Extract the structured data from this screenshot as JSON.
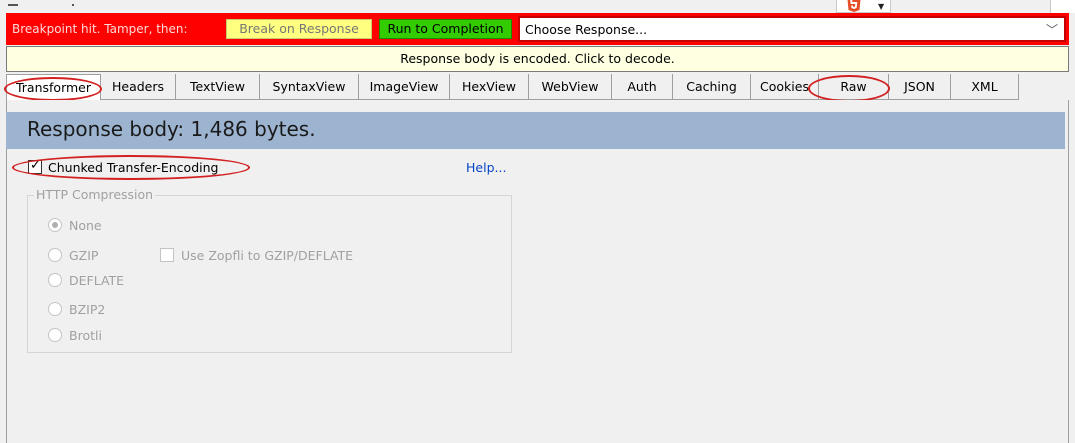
{
  "breakpoint": {
    "label": "Breakpoint hit. Tamper, then:",
    "break_on_response": "Break on Response",
    "run_to_completion": "Run to Completion",
    "choose_response": "Choose Response..."
  },
  "notice": "Response body is encoded. Click to decode.",
  "tabs": [
    "Transformer",
    "Headers",
    "TextView",
    "SyntaxView",
    "ImageView",
    "HexView",
    "WebView",
    "Auth",
    "Caching",
    "Cookies",
    "Raw",
    "JSON",
    "XML"
  ],
  "active_tab": "Transformer",
  "response_body": "Response body: 1,486 bytes.",
  "chunked": {
    "label": "Chunked Transfer-Encoding",
    "checked": true
  },
  "help": "Help...",
  "compression": {
    "title": "HTTP Compression",
    "options": [
      "None",
      "GZIP",
      "DEFLATE",
      "BZIP2",
      "Brotli"
    ],
    "selected": "None",
    "zopfli_label": "Use Zopfli to GZIP/DEFLATE",
    "zopfli_checked": false
  },
  "colors": {
    "breakpoint_bar": "#ff0000",
    "break_button": "#ffff80",
    "run_button": "#33cc00",
    "notice_bg": "#ffffe1",
    "header_band": "#9db4d1",
    "annotation": "#d32020"
  }
}
